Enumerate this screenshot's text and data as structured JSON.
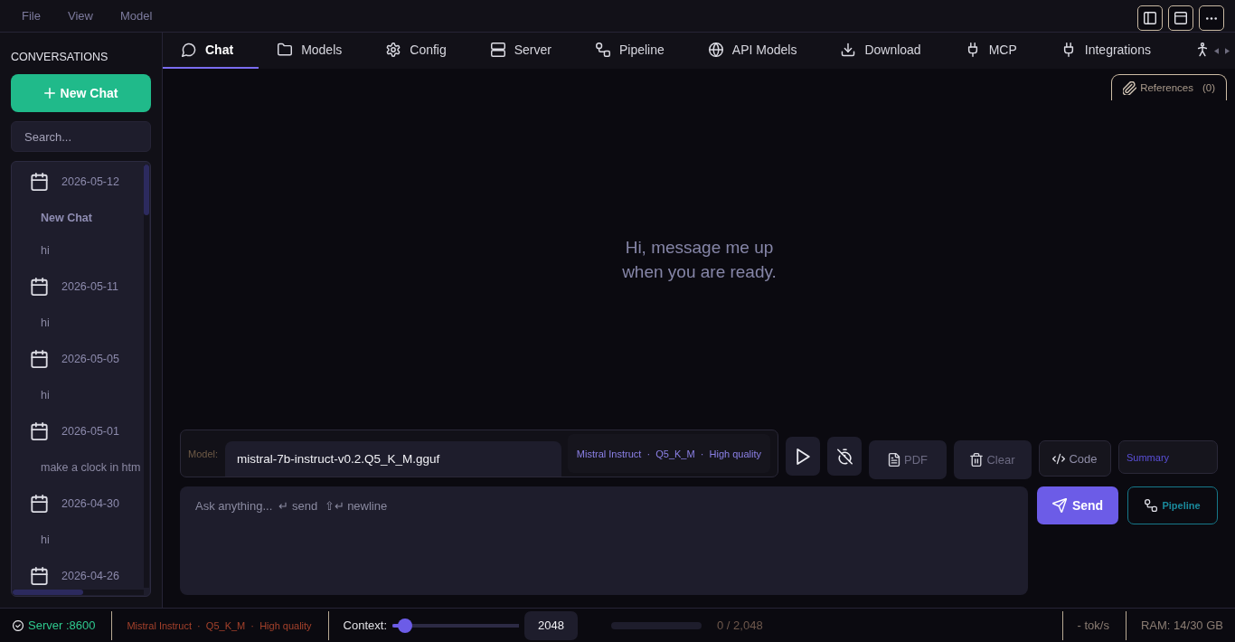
{
  "menu": [
    {
      "label": "File"
    },
    {
      "label": "View"
    },
    {
      "label": "Model"
    }
  ],
  "sidebar": {
    "title": "CONVERSATIONS",
    "new_chat": {
      "label": "New Chat"
    },
    "search": {
      "placeholder": "Search..."
    },
    "groups": [
      {
        "date": "2026-05-12",
        "items": [
          {
            "title": "New Chat",
            "selected": true
          },
          {
            "title": "hi",
            "selected": false
          }
        ]
      },
      {
        "date": "2026-05-11",
        "items": [
          {
            "title": "hi",
            "selected": false
          }
        ]
      },
      {
        "date": "2026-05-05",
        "items": [
          {
            "title": "hi",
            "selected": false
          }
        ]
      },
      {
        "date": "2026-05-01",
        "items": [
          {
            "title": "make a clock in htm",
            "selected": false
          }
        ]
      },
      {
        "date": "2026-04-30",
        "items": [
          {
            "title": "hi",
            "selected": false
          }
        ]
      },
      {
        "date": "2026-04-26"
      }
    ]
  },
  "tabs": [
    {
      "kind": "chat",
      "label": "Chat",
      "selected": true
    },
    {
      "kind": "models",
      "label": "Models",
      "selected": false
    },
    {
      "kind": "config",
      "label": "Config",
      "selected": false
    },
    {
      "kind": "server",
      "label": "Server",
      "selected": false
    },
    {
      "kind": "pipeline",
      "label": "Pipeline",
      "selected": false
    },
    {
      "kind": "api",
      "label": "API Models",
      "selected": false
    },
    {
      "kind": "download",
      "label": "Download",
      "selected": false
    },
    {
      "kind": "mcp",
      "label": "MCP",
      "selected": false
    },
    {
      "kind": "integrations",
      "label": "Integrations",
      "selected": false
    },
    {
      "kind": "figure",
      "selected": false
    }
  ],
  "references": {
    "label": "References",
    "count": "(0)"
  },
  "empty_state": {
    "text": "Hi, message me up\nwhen you are ready."
  },
  "model_bar": {
    "label": "Model:",
    "value": "mistral-7b-instruct-v0.2.Q5_K_M.gguf",
    "tags": "Mistral Instruct  ·  Q5_K_M  ·  High quality"
  },
  "actions": [
    {
      "kind": "play"
    },
    {
      "kind": "timer-off"
    },
    {
      "kind": "pdf",
      "label": "PDF"
    },
    {
      "kind": "clear",
      "label": "Clear"
    },
    {
      "kind": "code",
      "label": "Code"
    },
    {
      "kind": "summary",
      "label": "Summary"
    }
  ],
  "composer": {
    "placeholder": "Ask anything...  ↵ send  ⇧↵ newline",
    "send": {
      "label": "Send"
    },
    "pipeline": {
      "label": "Pipeline"
    }
  },
  "status_bar": {
    "server": "Server :8600",
    "model_tags": "Mistral Instruct  ·  Q5_K_M  ·  High quality",
    "context_label": "Context:",
    "context_slider": {
      "level": 0.1
    },
    "context_value": "2048",
    "usage": {
      "level": 0
    },
    "usage_text": "0 / 2,048",
    "speed": "- tok/s",
    "ram": "RAM: 14/30 GB"
  }
}
